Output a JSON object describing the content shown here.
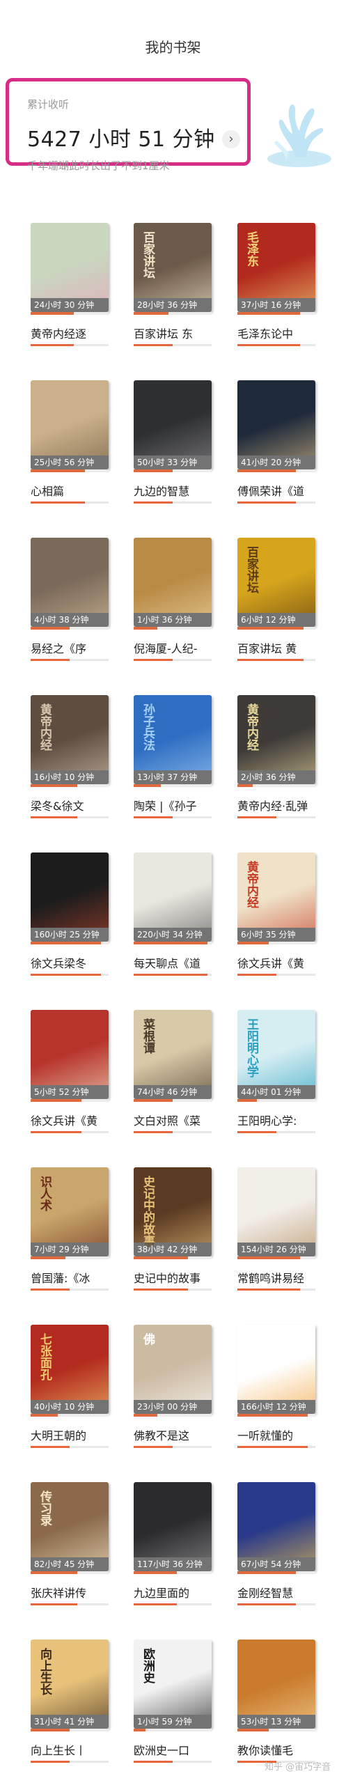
{
  "header": {
    "title": "我的书架"
  },
  "stats": {
    "label": "累计收听",
    "total_time": "5427 小时 51 分钟",
    "subtitle": "千年珊瑚此时长出了不到1厘米",
    "arrow": "›"
  },
  "books": [
    {
      "title": "黄帝内经逐",
      "duration": "24小时 30 分钟",
      "progress": 0.55,
      "cover_color": "#c9d6c0",
      "accent": "#e8a3b7",
      "cover_text": ""
    },
    {
      "title": "百家讲坛 东",
      "duration": "28小时 36 分钟",
      "progress": 0.45,
      "cover_color": "#6b5a49",
      "accent": "#f2e6c8",
      "cover_text": "百家讲坛"
    },
    {
      "title": "毛泽东论中",
      "duration": "37小时 16 分钟",
      "progress": 0.8,
      "cover_color": "#b22a1d",
      "accent": "#f3d27a",
      "cover_text": "毛泽东"
    },
    {
      "title": "心相篇",
      "duration": "25小时 56 分钟",
      "progress": 0.7,
      "cover_color": "#cbb18b",
      "accent": "#6e5a40",
      "cover_text": ""
    },
    {
      "title": "九边的智慧",
      "duration": "50小时 33 分钟",
      "progress": 0.5,
      "cover_color": "#2e2f33",
      "accent": "#8f8f8f",
      "cover_text": ""
    },
    {
      "title": "傅佩荣讲《道",
      "duration": "41小时 20 分钟",
      "progress": 0.75,
      "cover_color": "#1e2a3a",
      "accent": "#e0c08a",
      "cover_text": ""
    },
    {
      "title": "易经之《序",
      "duration": "4小时 38 分钟",
      "progress": 0.5,
      "cover_color": "#7a6a5a",
      "accent": "#d9c09a",
      "cover_text": ""
    },
    {
      "title": "倪海厦-人纪-",
      "duration": "1小时 36 分钟",
      "progress": 0.3,
      "cover_color": "#b88a45",
      "accent": "#f0d9a5",
      "cover_text": ""
    },
    {
      "title": "百家讲坛 黄",
      "duration": "6小时 12 分钟",
      "progress": 0.85,
      "cover_color": "#d7a51c",
      "accent": "#5a3b12",
      "cover_text": "百家讲坛"
    },
    {
      "title": "梁冬&徐文",
      "duration": "16小时 10 分钟",
      "progress": 0.6,
      "cover_color": "#5e4e42",
      "accent": "#d9c7b0",
      "cover_text": "黄帝内经"
    },
    {
      "title": "陶荣 |《孙子",
      "duration": "13小时 37 分钟",
      "progress": 0.35,
      "cover_color": "#2e6ec2",
      "accent": "#a8d0f5",
      "cover_text": "孙子兵法"
    },
    {
      "title": "黄帝内经·乱弹",
      "duration": "2小时 36 分钟",
      "progress": 0.2,
      "cover_color": "#3d3a38",
      "accent": "#e9d79b",
      "cover_text": "黄帝内经"
    },
    {
      "title": "徐文兵梁冬",
      "duration": "160小时 25 分钟",
      "progress": 0.9,
      "cover_color": "#1c1c1c",
      "accent": "#b5462d",
      "cover_text": ""
    },
    {
      "title": "每天聊点《道",
      "duration": "220小时 34 分钟",
      "progress": 0.95,
      "cover_color": "#e9e6df",
      "accent": "#555555",
      "cover_text": ""
    },
    {
      "title": "徐文兵讲《黄",
      "duration": "6小时 35 分钟",
      "progress": 0.4,
      "cover_color": "#efe2c8",
      "accent": "#c43a24",
      "cover_text": "黄帝内经"
    },
    {
      "title": "徐文兵讲《黄",
      "duration": "5小时 52 分钟",
      "progress": 0.65,
      "cover_color": "#b7342b",
      "accent": "#f2e1c5",
      "cover_text": ""
    },
    {
      "title": "文白对照《菜",
      "duration": "74小时 46 分钟",
      "progress": 0.5,
      "cover_color": "#d8c9a8",
      "accent": "#4a3a2a",
      "cover_text": "菜根谭"
    },
    {
      "title": "王阳明心学:",
      "duration": "44小时 01 分钟",
      "progress": 0.25,
      "cover_color": "#d6eef2",
      "accent": "#2aa0c0",
      "cover_text": "王阳明心学"
    },
    {
      "title": "曾国藩:《冰",
      "duration": "7小时 29 分钟",
      "progress": 0.45,
      "cover_color": "#c9a66b",
      "accent": "#6a2a1a",
      "cover_text": "识人术"
    },
    {
      "title": "史记中的故事",
      "duration": "38小时 42 分钟",
      "progress": 0.7,
      "cover_color": "#5a3a22",
      "accent": "#e8c27a",
      "cover_text": "史记中的故事"
    },
    {
      "title": "常鹤鸣讲易经",
      "duration": "154小时 26 分钟",
      "progress": 0.8,
      "cover_color": "#f2eee8",
      "accent": "#b08a5a",
      "cover_text": ""
    },
    {
      "title": "大明王朝的",
      "duration": "40小时 10 分钟",
      "progress": 0.35,
      "cover_color": "#b32b1e",
      "accent": "#f0c86e",
      "cover_text": "七张面孔"
    },
    {
      "title": "佛教不是这",
      "duration": "23小时 00 分钟",
      "progress": 0.3,
      "cover_color": "#ccbba3",
      "accent": "#ffffff",
      "cover_text": "佛"
    },
    {
      "title": "一听就懂的",
      "duration": "166小时 12 分钟",
      "progress": 0.9,
      "cover_color": "#ffffff",
      "accent": "#f0a23a",
      "cover_text": ""
    },
    {
      "title": "张庆祥讲传",
      "duration": "82小时 45 分钟",
      "progress": 0.6,
      "cover_color": "#8a6a4a",
      "accent": "#f5e6c8",
      "cover_text": "传习录"
    },
    {
      "title": "九边里面的",
      "duration": "117小时 36 分钟",
      "progress": 0.55,
      "cover_color": "#2b2b2e",
      "accent": "#9a9a9a",
      "cover_text": ""
    },
    {
      "title": "金刚经智慧",
      "duration": "67小时 54 分钟",
      "progress": 0.75,
      "cover_color": "#2a3a8a",
      "accent": "#f5c84a",
      "cover_text": ""
    },
    {
      "title": "向上生长丨",
      "duration": "31小时 41 分钟",
      "progress": 0.5,
      "cover_color": "#e8c27a",
      "accent": "#3a2a1a",
      "cover_text": "向上生长"
    },
    {
      "title": "欧洲史一口",
      "duration": "1小时 59 分钟",
      "progress": 0.15,
      "cover_color": "#f2f2f2",
      "accent": "#1a1a1a",
      "cover_text": "欧洲史"
    },
    {
      "title": "教你读懂毛",
      "duration": "53小时 13 分钟",
      "progress": 0.4,
      "cover_color": "#c97a2a",
      "accent": "#f5d9a0",
      "cover_text": ""
    }
  ],
  "watermark": "知乎 @宙巧字音"
}
